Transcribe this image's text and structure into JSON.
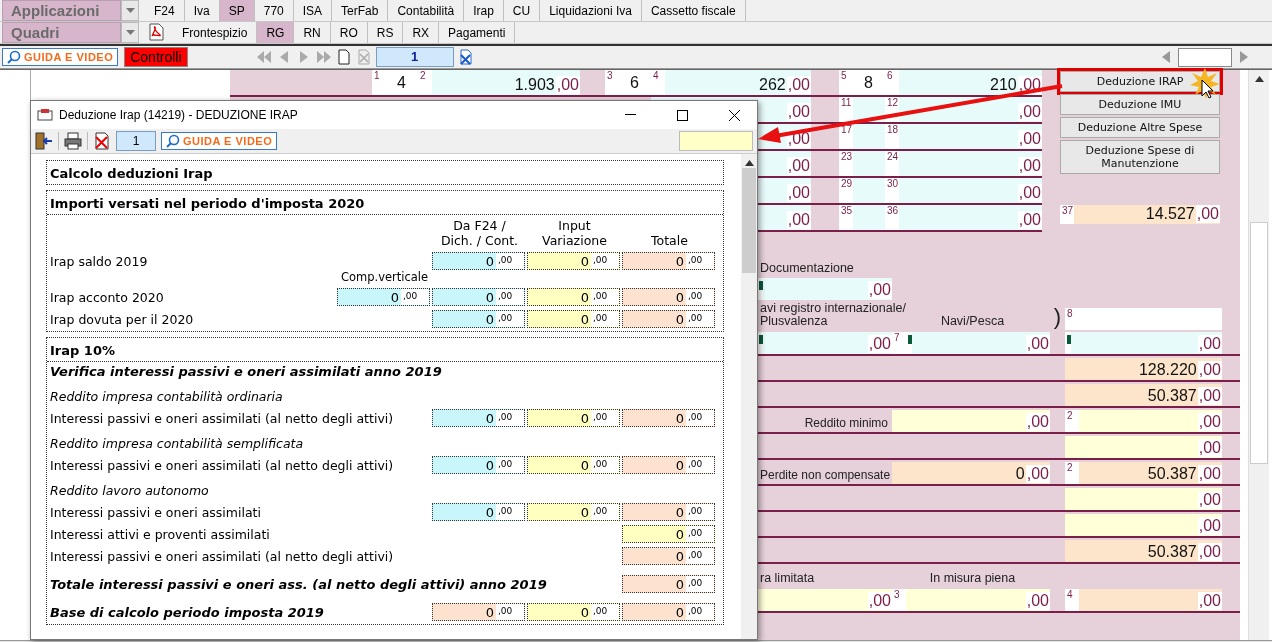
{
  "menu": {
    "app_select": "Applicazioni",
    "section_select": "Quadri",
    "tabs": [
      {
        "label": "F24",
        "selected": false
      },
      {
        "label": "Iva",
        "selected": false
      },
      {
        "label": "SP",
        "selected": true
      },
      {
        "label": "770",
        "selected": false
      },
      {
        "label": "ISA",
        "selected": false
      },
      {
        "label": "TerFab",
        "selected": false
      },
      {
        "label": "Contabilità",
        "selected": false
      },
      {
        "label": "Irap",
        "selected": false
      },
      {
        "label": "CU",
        "selected": false
      },
      {
        "label": "Liquidazioni Iva",
        "selected": false
      },
      {
        "label": "Cassetto fiscale",
        "selected": false
      }
    ],
    "subtabs": [
      {
        "label": "Frontespizio",
        "selected": false
      },
      {
        "label": "RG",
        "selected": true
      },
      {
        "label": "RN",
        "selected": false
      },
      {
        "label": "RO",
        "selected": false
      },
      {
        "label": "RS",
        "selected": false
      },
      {
        "label": "RX",
        "selected": false
      },
      {
        "label": "Pagamenti",
        "selected": false
      }
    ]
  },
  "toolbar": {
    "guide": "GUIDA E VIDEO",
    "controls": "Controlli",
    "page": "1"
  },
  "form": {
    "top_rows": [
      {
        "cells": [
          {
            "kind": "digit",
            "num": "1",
            "value": "4"
          },
          {
            "kind": "amount",
            "num": "2",
            "value": "1.903",
            "decimals": ",00",
            "color": "#e8fbfb"
          },
          {
            "kind": "digit",
            "num": "3",
            "value": "6"
          },
          {
            "kind": "amount",
            "num": "4",
            "value": "262",
            "decimals": ",00",
            "color": "#e8fbfb"
          },
          {
            "kind": "digit",
            "num": "5",
            "value": "8"
          },
          {
            "kind": "amount",
            "num": "6",
            "value": "210",
            "decimals": ",00",
            "color": "#e8fbfb"
          }
        ]
      },
      {
        "cells": [
          {
            "kind": "amount",
            "decimals": ",00",
            "color": "#e8fbfb"
          },
          {
            "kind": "digit",
            "num": "11"
          },
          {
            "kind": "amount",
            "num": "12",
            "decimals": ",00",
            "color": "#e8fbfb"
          }
        ]
      },
      {
        "cells": [
          {
            "kind": "amount",
            "decimals": ",00",
            "color": "#e8fbfb"
          },
          {
            "kind": "digit",
            "num": "17"
          },
          {
            "kind": "amount",
            "num": "18",
            "decimals": ",00",
            "color": "#e8fbfb"
          }
        ]
      },
      {
        "cells": [
          {
            "kind": "amount",
            "decimals": ",00",
            "color": "#e8fbfb"
          },
          {
            "kind": "digit",
            "num": "23"
          },
          {
            "kind": "amount",
            "num": "24",
            "decimals": ",00",
            "color": "#e8fbfb"
          }
        ]
      },
      {
        "cells": [
          {
            "kind": "amount",
            "decimals": ",00",
            "color": "#e8fbfb"
          },
          {
            "kind": "digit",
            "num": "29"
          },
          {
            "kind": "amount",
            "num": "30",
            "decimals": ",00",
            "color": "#e8fbfb"
          }
        ]
      },
      {
        "cells": [
          {
            "kind": "amount",
            "decimals": ",00",
            "color": "#e8fbfb"
          },
          {
            "kind": "digit",
            "num": "35"
          },
          {
            "kind": "amount",
            "num": "36",
            "decimals": ",00",
            "color": "#e8fbfb"
          }
        ]
      }
    ],
    "side_buttons": [
      {
        "label": "Deduzione IRAP",
        "highlighted": true
      },
      {
        "label": "Deduzione IMU",
        "highlighted": false
      },
      {
        "label": "Deduzione Altre Spese",
        "highlighted": false
      },
      {
        "label": "Deduzione Spese di Manutenzione",
        "highlighted": false
      }
    ],
    "total": {
      "num": "37",
      "value": "14.527",
      "decimals": ",00",
      "color": "#fde5cc"
    },
    "lower_rows": [
      {
        "kind": "plain",
        "a": {
          "kind": "label",
          "text": "Documentazione"
        }
      },
      {
        "kind": "plain",
        "a": {
          "kind": "amount",
          "decimals": ",00",
          "color": "#e8fbfb",
          "marked": true
        }
      },
      {
        "kind": "plain",
        "a": {
          "kind": "label",
          "text": "avi registro internazionale/\nPlusvalenza"
        },
        "b": {
          "kind": "label",
          "text": "Navi/Pesca"
        },
        "g": {
          "kind": "text",
          "text": ")"
        },
        "c": {
          "kind": "num",
          "num": "8"
        }
      },
      {
        "kind": "ruled",
        "a": {
          "kind": "amount",
          "decimals": ",00",
          "color": "#e8fbfb",
          "marked": true
        },
        "b": {
          "kind": "amount",
          "num": "7",
          "decimals": ",00",
          "color": "#e8fbfb",
          "marked": true
        },
        "c": {
          "kind": "amount",
          "decimals": ",00",
          "color": "#e8fbfb",
          "marked": true
        }
      },
      {
        "kind": "ruled",
        "c": {
          "kind": "amount",
          "value": "128.220",
          "decimals": ",00",
          "color": "#fde5cc"
        }
      },
      {
        "kind": "ruled",
        "c": {
          "kind": "amount",
          "value": "50.387",
          "decimals": ",00",
          "color": "#fde5cc"
        }
      },
      {
        "kind": "ruled",
        "a": {
          "kind": "label",
          "text": "Reddito minimo"
        },
        "b": {
          "kind": "amount",
          "decimals": ",00",
          "color": "#ffffd8"
        },
        "c": {
          "kind": "amount",
          "num": "2",
          "decimals": ",00",
          "color": "#ffffd8"
        }
      },
      {
        "kind": "ruled",
        "c": {
          "kind": "amount",
          "decimals": ",00",
          "color": "#ffffd8"
        }
      },
      {
        "kind": "ruled",
        "a": {
          "kind": "label",
          "text": "Perdite non compensate"
        },
        "b": {
          "kind": "amount",
          "value": "0",
          "decimals": ",00",
          "color": "#fde5cc"
        },
        "c": {
          "kind": "amount",
          "num": "2",
          "value": "50.387",
          "decimals": ",00",
          "color": "#fde5cc"
        }
      },
      {
        "kind": "ruled",
        "c": {
          "kind": "amount",
          "decimals": ",00",
          "color": "#ffffd8"
        }
      },
      {
        "kind": "ruled",
        "c": {
          "kind": "amount",
          "decimals": ",00",
          "color": "#ffffd8"
        }
      },
      {
        "kind": "ruled",
        "c": {
          "kind": "amount",
          "value": "50.387",
          "decimals": ",00",
          "color": "#fde5cc"
        }
      },
      {
        "kind": "plain",
        "a": {
          "kind": "label",
          "text": "ra limitata"
        },
        "b": {
          "kind": "label",
          "text": "In misura piena"
        }
      },
      {
        "kind": "ruled",
        "a": {
          "kind": "amount",
          "decimals": ",00",
          "color": "#ffffd8"
        },
        "b": {
          "kind": "amount",
          "num": "3",
          "decimals": ",00",
          "color": "#ffffd8"
        },
        "c": {
          "kind": "amount",
          "num": "4",
          "decimals": ",00",
          "color": "#fde5cc"
        }
      }
    ]
  },
  "dialog": {
    "title": "Deduzione Irap (14219) - DEDUZIONE IRAP",
    "page": "1",
    "guide": "GUIDA E VIDEO",
    "sections": [
      {
        "heading": "Calcolo deduzioni Irap"
      },
      {
        "heading": "Importi versati nel periodo d'imposta 2020",
        "columns": [
          "Da F24 /\nDich. / Cont.",
          "Input\nVariazione",
          "Totale"
        ],
        "rows": [
          {
            "kind": "line",
            "label": "Irap saldo 2019",
            "values": [
              {
                "value": "0",
                "decimals": ",00",
                "color": "#c8f6fb"
              },
              {
                "value": "0",
                "decimals": ",00",
                "color": "#ffffc0"
              },
              {
                "value": "0",
                "decimals": ",00",
                "color": "#fde3cf"
              }
            ]
          },
          {
            "kind": "line",
            "label": "Irap acconto 2020",
            "caption": "Comp.verticale",
            "values": [
              {
                "value": "0",
                "decimals": ",00",
                "color": "#c8f6fb"
              },
              {
                "value": "0",
                "decimals": ",00",
                "color": "#c8f6fb"
              },
              {
                "value": "0",
                "decimals": ",00",
                "color": "#ffffc0"
              },
              {
                "value": "0",
                "decimals": ",00",
                "color": "#fde3cf"
              }
            ]
          },
          {
            "kind": "line",
            "label": "Irap dovuta per il 2020",
            "values": [
              {
                "value": "0",
                "decimals": ",00",
                "color": "#c8f6fb"
              },
              {
                "value": "0",
                "decimals": ",00",
                "color": "#ffffc0"
              },
              {
                "value": "0",
                "decimals": ",00",
                "color": "#fde3cf"
              }
            ]
          }
        ]
      },
      {
        "heading": "Irap 10%",
        "rows": [
          {
            "kind": "title",
            "label": "Verifica interessi passivi e oneri assimilati anno 2019"
          },
          {
            "kind": "subtitle",
            "label": "Reddito impresa contabilità ordinaria"
          },
          {
            "kind": "line",
            "label": "Interessi passivi e oneri assimilati (al netto degli attivi)",
            "values": [
              {
                "value": "0",
                "decimals": ",00",
                "color": "#c8f6fb"
              },
              {
                "value": "0",
                "decimals": ",00",
                "color": "#ffffc0"
              },
              {
                "value": "0",
                "decimals": ",00",
                "color": "#fde3cf"
              }
            ]
          },
          {
            "kind": "subtitle",
            "label": "Reddito impresa contabilità semplificata"
          },
          {
            "kind": "line",
            "label": "Interessi passivi e oneri assimilati (al netto degli attivi)",
            "values": [
              {
                "value": "0",
                "decimals": ",00",
                "color": "#c8f6fb"
              },
              {
                "value": "0",
                "decimals": ",00",
                "color": "#ffffc0"
              },
              {
                "value": "0",
                "decimals": ",00",
                "color": "#fde3cf"
              }
            ]
          },
          {
            "kind": "subtitle",
            "label": "Reddito lavoro autonomo"
          },
          {
            "kind": "line",
            "label": "Interessi passivi e oneri assimilati",
            "values": [
              {
                "value": "0",
                "decimals": ",00",
                "color": "#c8f6fb"
              },
              {
                "value": "0",
                "decimals": ",00",
                "color": "#ffffc0"
              },
              {
                "value": "0",
                "decimals": ",00",
                "color": "#fde3cf"
              }
            ]
          },
          {
            "kind": "line",
            "label": "Interessi attivi e proventi assimilati",
            "values": [
              {
                "value": "0",
                "decimals": ",00",
                "color": "#ffffc0"
              }
            ]
          },
          {
            "kind": "line",
            "label": "Interessi passivi e oneri assimilati (al netto degli attivi)",
            "values": [
              {
                "value": "0",
                "decimals": ",00",
                "color": "#fde3cf"
              }
            ]
          },
          {
            "kind": "total",
            "label": "Totale interessi passivi e oneri ass. (al netto degli attivi) anno 2019",
            "values": [
              {
                "value": "0",
                "decimals": ",00",
                "color": "#fde3cf"
              }
            ]
          },
          {
            "kind": "total",
            "label": "Base di calcolo periodo imposta 2019",
            "values": [
              {
                "value": "0",
                "decimals": ",00",
                "color": "#fde3cf"
              },
              {
                "value": "0",
                "decimals": ",00",
                "color": "#ffffc0"
              },
              {
                "value": "0",
                "decimals": ",00",
                "color": "#fde3cf"
              }
            ]
          }
        ]
      }
    ]
  }
}
